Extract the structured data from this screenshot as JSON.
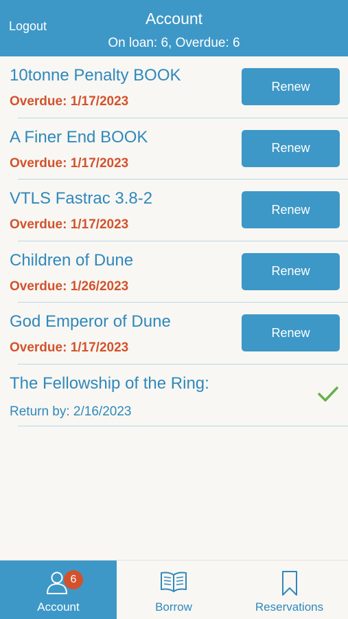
{
  "header": {
    "logout_label": "Logout",
    "title": "Account",
    "subtitle": "On loan: 6, Overdue: 6"
  },
  "loans": [
    {
      "title": "10tonne Penalty BOOK",
      "status": "Overdue: 1/17/2023",
      "action": "Renew"
    },
    {
      "title": "A Finer End BOOK",
      "status": "Overdue: 1/17/2023",
      "action": "Renew"
    },
    {
      "title": "VTLS Fastrac 3.8-2",
      "status": "Overdue: 1/17/2023",
      "action": "Renew"
    },
    {
      "title": "Children of Dune",
      "status": "Overdue: 1/26/2023",
      "action": "Renew"
    },
    {
      "title": "God Emperor of Dune",
      "status": "Overdue: 1/17/2023",
      "action": "Renew"
    },
    {
      "title": "The Fellowship of the Ring:",
      "status": "Return by: 2/16/2023",
      "icon": "checkmark-icon"
    }
  ],
  "tabbar": {
    "tabs": [
      {
        "label": "Account",
        "icon": "user-icon",
        "badge": "6"
      },
      {
        "label": "Borrow",
        "icon": "open-book-icon"
      },
      {
        "label": "Reservations",
        "icon": "bookmark-icon"
      }
    ]
  },
  "colors": {
    "brand_blue": "#3d98c7",
    "title_blue": "#2f88bc",
    "overdue_red": "#d3522c",
    "check_green": "#66b04a",
    "background": "#f8f7f3"
  }
}
